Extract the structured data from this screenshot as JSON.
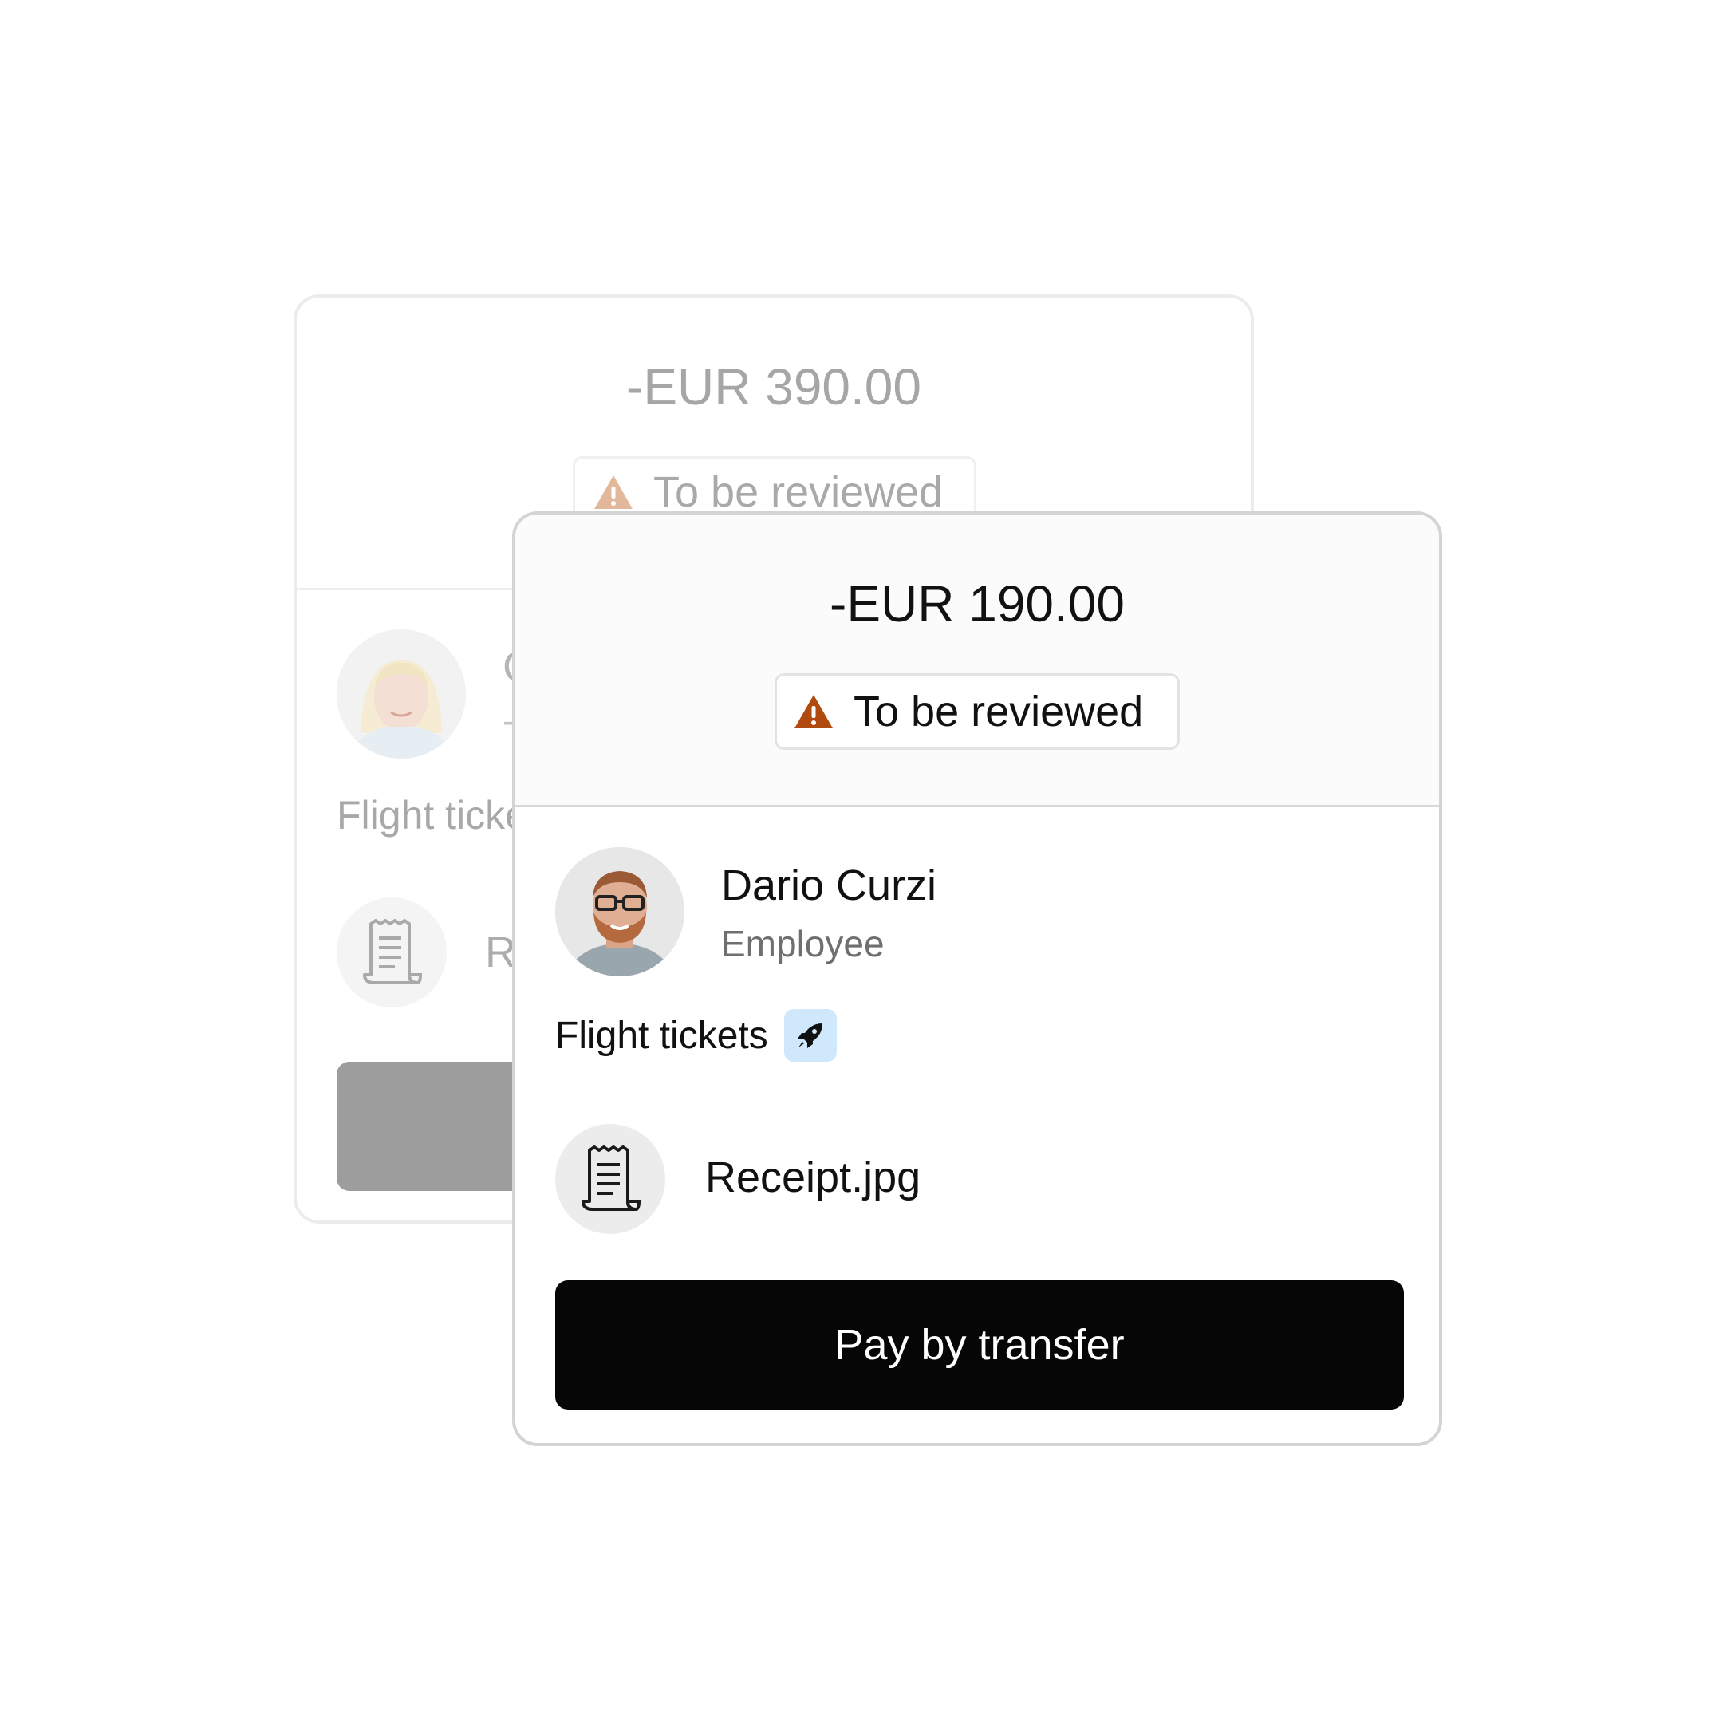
{
  "back_card": {
    "amount": "-EUR 390.00",
    "status": "To be reviewed",
    "name_fragment": "C",
    "role_fragment": "-",
    "category_fragment": "Flight ticke",
    "receipt_fragment": "R",
    "status_icon": "warning-icon",
    "receipt_icon": "receipt-icon"
  },
  "front_card": {
    "amount": "-EUR 190.00",
    "status": "To be reviewed",
    "employee_name": "Dario Curzi",
    "employee_role": "Employee",
    "category": "Flight tickets",
    "category_icon": "rocket-icon",
    "receipt_file": "Receipt.jpg",
    "receipt_icon": "receipt-icon",
    "pay_button_label": "Pay by transfer",
    "status_icon": "warning-icon"
  },
  "colors": {
    "warning_front": "#b04a0e",
    "warning_back": "#e2b79a",
    "category_tag_bg": "#cfe8fb",
    "button_front": "#060606",
    "button_back": "#9d9d9d"
  }
}
